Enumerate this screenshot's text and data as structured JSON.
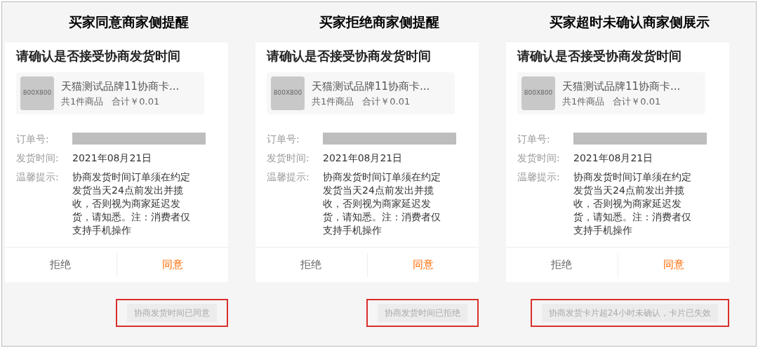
{
  "panels": [
    {
      "heading": "买家同意商家侧提醒",
      "card": {
        "title": "请确认是否接受协商发货时间",
        "product": {
          "thumb": "800X800",
          "name": "天猫测试品牌11协商卡...",
          "count": "共1件商品",
          "total": "合计￥0.01"
        },
        "fields": [
          {
            "label": "订单号:",
            "kind": "redacted"
          },
          {
            "label": "发货时间:",
            "kind": "text",
            "value": "2021年08月21日"
          },
          {
            "label": "温馨提示:",
            "kind": "text",
            "value": "协商发货时间订单须在约定发货当天24点前发出并揽收，否则视为商家延迟发货，请知悉。注：消费者仅支持手机操作"
          }
        ],
        "buttons": [
          {
            "label": "拒绝",
            "kind": "secondary"
          },
          {
            "label": "同意",
            "kind": "primary"
          }
        ]
      },
      "status": "协商发货时间已同意"
    },
    {
      "heading": "买家拒绝商家侧提醒",
      "card": {
        "title": "请确认是否接受协商发货时间",
        "product": {
          "thumb": "800X800",
          "name": "天猫测试品牌11协商卡...",
          "count": "共1件商品",
          "total": "合计￥0.01"
        },
        "fields": [
          {
            "label": "订单号:",
            "kind": "redacted"
          },
          {
            "label": "发货时间:",
            "kind": "text",
            "value": "2021年08月21日"
          },
          {
            "label": "温馨提示:",
            "kind": "text",
            "value": "协商发货时间订单须在约定发货当天24点前发出并揽收，否则视为商家延迟发货，请知悉。注：消费者仅支持手机操作"
          }
        ],
        "buttons": [
          {
            "label": "拒绝",
            "kind": "secondary"
          },
          {
            "label": "同意",
            "kind": "primary"
          }
        ]
      },
      "status": "协商发货时间已拒绝"
    },
    {
      "heading": "买家超时未确认商家侧展示",
      "card": {
        "title": "请确认是否接受协商发货时间",
        "product": {
          "thumb": "800X800",
          "name": "天猫测试品牌11协商卡...",
          "count": "共1件商品",
          "total": "合计￥0.01"
        },
        "fields": [
          {
            "label": "订单号:",
            "kind": "redacted"
          },
          {
            "label": "发货时间:",
            "kind": "text",
            "value": "2021年08月21日"
          },
          {
            "label": "温馨提示:",
            "kind": "text",
            "value": "协商发货时间订单须在约定发货当天24点前发出并揽收，否则视为商家延迟发货，请知悉。注：消费者仅支持手机操作"
          }
        ],
        "buttons": [
          {
            "label": "拒绝",
            "kind": "secondary"
          },
          {
            "label": "同意",
            "kind": "primary"
          }
        ]
      },
      "status": "协商发货卡片超24小时未确认，卡片已失效"
    }
  ]
}
